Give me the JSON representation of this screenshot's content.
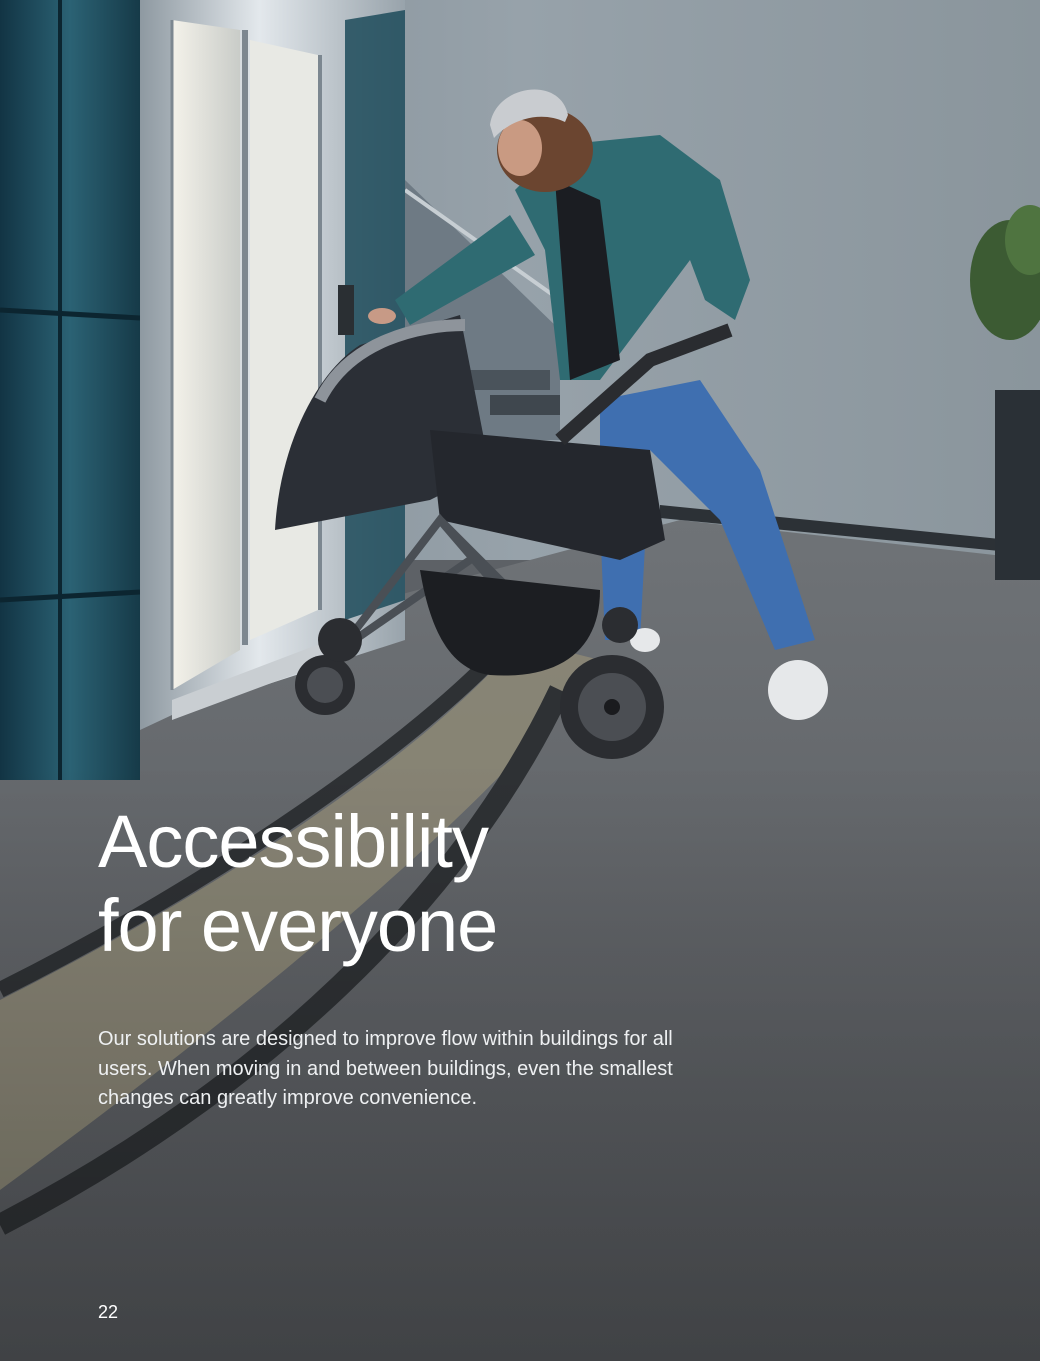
{
  "photo": {
    "icon": "elevator-scene-photo",
    "colors": {
      "wall": "#8b969e",
      "floor": "#5e6166",
      "terrazzo": "#8f8a78",
      "jacket": "#2f6b72",
      "jeans": "#3f6fb0",
      "steel": "#b8c2ca",
      "glass": "#1f4a5a"
    }
  },
  "heading": {
    "line1": "Accessibility",
    "line2": "for everyone"
  },
  "body": {
    "line1": "Our solutions are designed to improve flow within buildings for all",
    "line2": "users. When moving in and between buildings, even the smallest",
    "line3": "changes can greatly improve convenience."
  },
  "page_number": "22"
}
